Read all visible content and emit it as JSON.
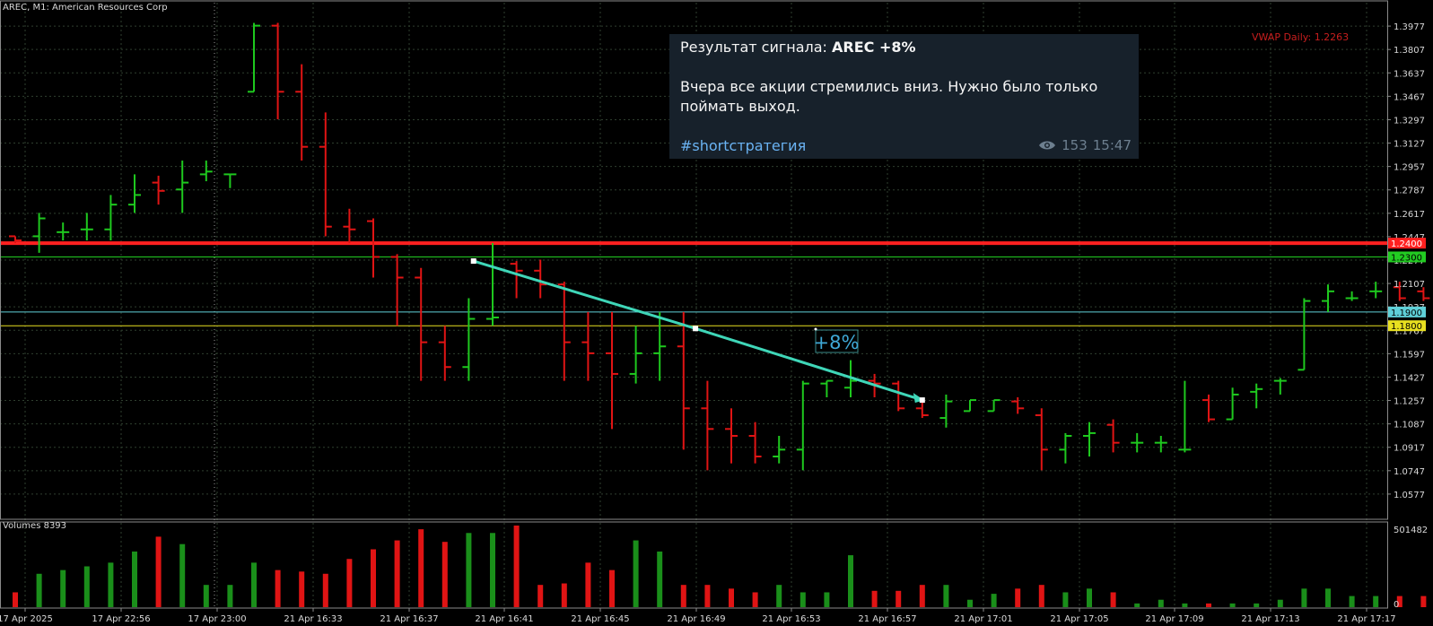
{
  "chart_header": {
    "symbol_label": "AREC, M1:  American Resources Corp"
  },
  "volume_header": {
    "label": "Volumes 8393"
  },
  "vwap_label": "VWAP Daily: 1.2263",
  "message": {
    "title_prefix": "Результат сигнала: ",
    "title_bold": "AREC +8%",
    "body": "Вчера все акции стремились вниз. Нужно было только поймать выход.",
    "hashtag": "#shortстратегия",
    "views": "153",
    "time": "15:47"
  },
  "trade_annotation": {
    "label": "+8%"
  },
  "colors": {
    "bull": "#1ec81e",
    "bear": "#e01414",
    "vol_bull": "#1a8f1a",
    "vol_bear": "#e01414",
    "resistance": "#ff1a1a",
    "support_green": "#2a8a2a",
    "level_cyan": "#5fd0d8",
    "level_yellow": "#e8e020",
    "trade_line": "#3fd6b8",
    "grid": "#2f3f2f",
    "card": "#17212b"
  },
  "price_levels": [
    {
      "name": "resistance",
      "value": 1.24,
      "label": "1.2400",
      "color": "#ff2020",
      "text_color": "#ffffff"
    },
    {
      "name": "green-level",
      "value": 1.23,
      "label": "1.2300",
      "color": "#22cc22",
      "text_color": "#000000"
    },
    {
      "name": "cyan-level",
      "value": 1.19,
      "label": "1.1900",
      "color": "#5fd0d8",
      "text_color": "#000000"
    },
    {
      "name": "yellow-level",
      "value": 1.18,
      "label": "1.1800",
      "color": "#e8e020",
      "text_color": "#000000"
    }
  ],
  "chart_data": {
    "type": "ohlc",
    "title": "AREC, M1:  American Resources Corp",
    "ylim": [
      1.0407,
      1.4147
    ],
    "y_ticks": [
      "1.3977",
      "1.3807",
      "1.3637",
      "1.3467",
      "1.3297",
      "1.3127",
      "1.2957",
      "1.2787",
      "1.2617",
      "1.2447",
      "1.2277",
      "1.2107",
      "1.1937",
      "1.1767",
      "1.1597",
      "1.1427",
      "1.1257",
      "1.1087",
      "1.0917",
      "1.0747",
      "1.0577"
    ],
    "x_ticks": [
      "17 Apr 2025",
      "17 Apr 22:56",
      "17 Apr 23:00",
      "21 Apr 16:33",
      "21 Apr 16:37",
      "21 Apr 16:41",
      "21 Apr 16:45",
      "21 Apr 16:49",
      "21 Apr 16:53",
      "21 Apr 16:57",
      "21 Apr 17:01",
      "21 Apr 17:05",
      "21 Apr 17:09",
      "21 Apr 17:13",
      "21 Apr 17:17"
    ],
    "volume_ylim": [
      0,
      501482
    ],
    "volume_ticks": [
      "501482",
      "0"
    ],
    "bars": [
      {
        "o": 1.245,
        "h": 1.245,
        "l": 1.24,
        "c": 1.242
      },
      {
        "o": 1.245,
        "h": 1.262,
        "l": 1.233,
        "c": 1.258
      },
      {
        "o": 1.248,
        "h": 1.255,
        "l": 1.242,
        "c": 1.248
      },
      {
        "o": 1.25,
        "h": 1.262,
        "l": 1.242,
        "c": 1.25
      },
      {
        "o": 1.25,
        "h": 1.275,
        "l": 1.242,
        "c": 1.268
      },
      {
        "o": 1.268,
        "h": 1.29,
        "l": 1.262,
        "c": 1.275
      },
      {
        "o": 1.284,
        "h": 1.289,
        "l": 1.268,
        "c": 1.278
      },
      {
        "o": 1.279,
        "h": 1.3,
        "l": 1.262,
        "c": 1.284
      },
      {
        "o": 1.29,
        "h": 1.3,
        "l": 1.285,
        "c": 1.292
      },
      {
        "o": 1.29,
        "h": 1.29,
        "l": 1.28,
        "c": 1.29
      },
      {
        "o": 1.35,
        "h": 1.4,
        "l": 1.35,
        "c": 1.398
      },
      {
        "o": 1.398,
        "h": 1.4,
        "l": 1.33,
        "c": 1.35
      },
      {
        "o": 1.35,
        "h": 1.37,
        "l": 1.3,
        "c": 1.31
      },
      {
        "o": 1.31,
        "h": 1.335,
        "l": 1.245,
        "c": 1.252
      },
      {
        "o": 1.252,
        "h": 1.265,
        "l": 1.24,
        "c": 1.25
      },
      {
        "o": 1.256,
        "h": 1.258,
        "l": 1.215,
        "c": 1.23
      },
      {
        "o": 1.23,
        "h": 1.232,
        "l": 1.18,
        "c": 1.215
      },
      {
        "o": 1.215,
        "h": 1.222,
        "l": 1.14,
        "c": 1.168
      },
      {
        "o": 1.168,
        "h": 1.18,
        "l": 1.14,
        "c": 1.15
      },
      {
        "o": 1.15,
        "h": 1.2,
        "l": 1.14,
        "c": 1.185
      },
      {
        "o": 1.185,
        "h": 1.24,
        "l": 1.18,
        "c": 1.186
      },
      {
        "o": 1.225,
        "h": 1.227,
        "l": 1.2,
        "c": 1.22
      },
      {
        "o": 1.22,
        "h": 1.228,
        "l": 1.2,
        "c": 1.21
      },
      {
        "o": 1.21,
        "h": 1.212,
        "l": 1.14,
        "c": 1.168
      },
      {
        "o": 1.168,
        "h": 1.19,
        "l": 1.14,
        "c": 1.16
      },
      {
        "o": 1.16,
        "h": 1.19,
        "l": 1.105,
        "c": 1.145
      },
      {
        "o": 1.145,
        "h": 1.18,
        "l": 1.138,
        "c": 1.16
      },
      {
        "o": 1.16,
        "h": 1.19,
        "l": 1.14,
        "c": 1.165
      },
      {
        "o": 1.165,
        "h": 1.19,
        "l": 1.09,
        "c": 1.12
      },
      {
        "o": 1.12,
        "h": 1.14,
        "l": 1.075,
        "c": 1.105
      },
      {
        "o": 1.105,
        "h": 1.12,
        "l": 1.08,
        "c": 1.1
      },
      {
        "o": 1.1,
        "h": 1.11,
        "l": 1.08,
        "c": 1.085
      },
      {
        "o": 1.085,
        "h": 1.1,
        "l": 1.08,
        "c": 1.09
      },
      {
        "o": 1.09,
        "h": 1.14,
        "l": 1.075,
        "c": 1.138
      },
      {
        "o": 1.138,
        "h": 1.14,
        "l": 1.128,
        "c": 1.14
      },
      {
        "o": 1.135,
        "h": 1.155,
        "l": 1.128,
        "c": 1.14
      },
      {
        "o": 1.14,
        "h": 1.145,
        "l": 1.128,
        "c": 1.138
      },
      {
        "o": 1.138,
        "h": 1.14,
        "l": 1.118,
        "c": 1.12
      },
      {
        "o": 1.12,
        "h": 1.125,
        "l": 1.113,
        "c": 1.115
      },
      {
        "o": 1.113,
        "h": 1.13,
        "l": 1.106,
        "c": 1.125
      },
      {
        "o": 1.118,
        "h": 1.126,
        "l": 1.118,
        "c": 1.126
      },
      {
        "o": 1.118,
        "h": 1.126,
        "l": 1.118,
        "c": 1.126
      },
      {
        "o": 1.125,
        "h": 1.128,
        "l": 1.116,
        "c": 1.12
      },
      {
        "o": 1.115,
        "h": 1.12,
        "l": 1.075,
        "c": 1.09
      },
      {
        "o": 1.09,
        "h": 1.102,
        "l": 1.08,
        "c": 1.1
      },
      {
        "o": 1.1,
        "h": 1.11,
        "l": 1.085,
        "c": 1.102
      },
      {
        "o": 1.108,
        "h": 1.112,
        "l": 1.088,
        "c": 1.095
      },
      {
        "o": 1.095,
        "h": 1.102,
        "l": 1.088,
        "c": 1.095
      },
      {
        "o": 1.095,
        "h": 1.1,
        "l": 1.088,
        "c": 1.095
      },
      {
        "o": 1.09,
        "h": 1.14,
        "l": 1.088,
        "c": 1.09
      },
      {
        "o": 1.126,
        "h": 1.13,
        "l": 1.11,
        "c": 1.112
      },
      {
        "o": 1.112,
        "h": 1.135,
        "l": 1.112,
        "c": 1.13
      },
      {
        "o": 1.132,
        "h": 1.138,
        "l": 1.12,
        "c": 1.134
      },
      {
        "o": 1.14,
        "h": 1.142,
        "l": 1.13,
        "c": 1.14
      },
      {
        "o": 1.148,
        "h": 1.2,
        "l": 1.148,
        "c": 1.198
      },
      {
        "o": 1.198,
        "h": 1.21,
        "l": 1.19,
        "c": 1.205
      },
      {
        "o": 1.2,
        "h": 1.205,
        "l": 1.198,
        "c": 1.2
      },
      {
        "o": 1.205,
        "h": 1.212,
        "l": 1.2,
        "c": 1.205
      },
      {
        "o": 1.208,
        "h": 1.212,
        "l": 1.198,
        "c": 1.2
      },
      {
        "o": 1.205,
        "h": 1.208,
        "l": 1.198,
        "c": 1.2
      },
      {
        "o": 1.2,
        "h": 1.206,
        "l": 1.198,
        "c": 1.205
      },
      {
        "o": 1.2,
        "h": 1.212,
        "l": 1.2,
        "c": 1.205
      },
      {
        "o": 1.21,
        "h": 1.22,
        "l": 1.2,
        "c": 1.21
      },
      {
        "o": 1.208,
        "h": 1.212,
        "l": 1.198,
        "c": 1.198
      },
      {
        "o": 1.198,
        "h": 1.21,
        "l": 1.198,
        "c": 1.2
      },
      {
        "o": 1.2,
        "h": 1.2,
        "l": 1.198,
        "c": 1.2
      },
      {
        "o": 1.198,
        "h": 1.235,
        "l": 1.198,
        "c": 1.225
      },
      {
        "o": 1.225,
        "h": 1.232,
        "l": 1.218,
        "c": 1.225
      },
      {
        "o": 1.225,
        "h": 1.23,
        "l": 1.214,
        "c": 1.22
      },
      {
        "o": 1.225,
        "h": 1.23,
        "l": 1.214,
        "c": 1.22
      },
      {
        "o": 1.215,
        "h": 1.23,
        "l": 1.215,
        "c": 1.228
      },
      {
        "o": 1.228,
        "h": 1.26,
        "l": 1.228,
        "c": 1.232
      },
      {
        "o": 1.235,
        "h": 1.24,
        "l": 1.228,
        "c": 1.235
      },
      {
        "o": 1.24,
        "h": 1.262,
        "l": 1.24,
        "c": 1.262
      }
    ],
    "volumes": [
      20,
      45,
      50,
      55,
      60,
      75,
      95,
      85,
      30,
      30,
      60,
      50,
      48,
      45,
      65,
      78,
      90,
      105,
      88,
      100,
      100,
      110,
      30,
      32,
      60,
      50,
      90,
      75,
      30,
      30,
      25,
      20,
      30,
      20,
      20,
      70,
      22,
      22,
      30,
      30,
      10,
      18,
      25,
      30,
      20,
      25,
      20,
      5,
      10,
      5,
      5,
      5,
      5,
      10,
      25,
      25,
      15,
      15,
      15,
      15,
      12,
      10,
      15,
      10,
      10,
      10,
      10,
      10,
      10,
      5,
      5,
      5,
      10,
      5
    ],
    "trade": {
      "from_price": 1.227,
      "mid_price": 1.178,
      "to_price": 1.126,
      "label": "+8%"
    }
  }
}
